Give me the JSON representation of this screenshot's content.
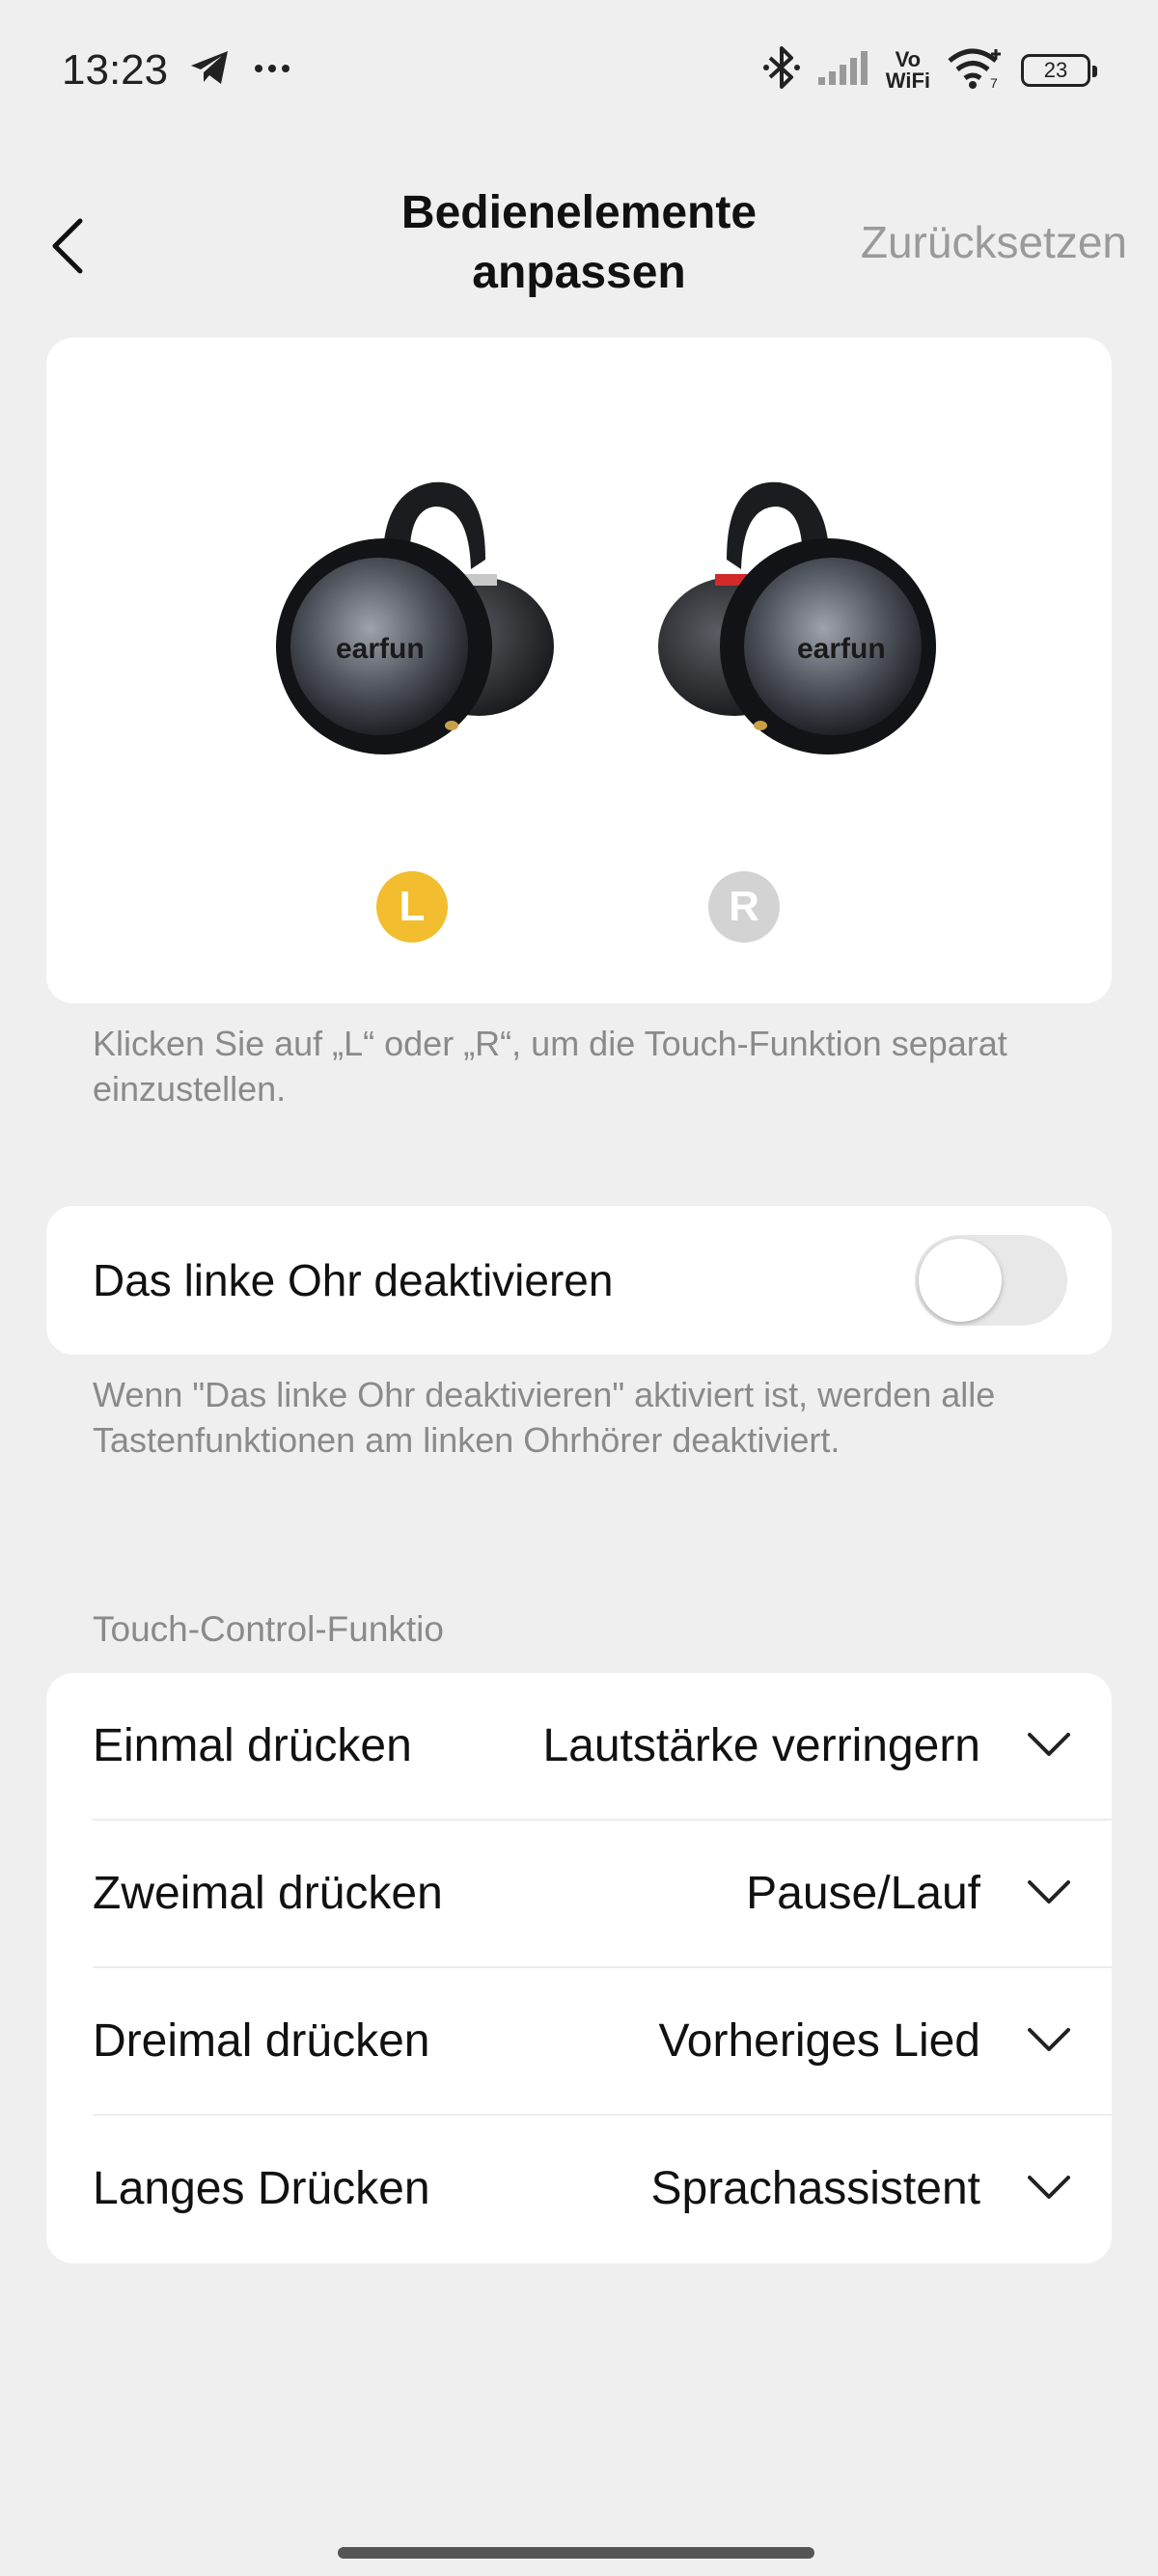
{
  "status_bar": {
    "time": "13:23",
    "left_icons": [
      "telegram-icon",
      "more-dots-icon"
    ],
    "vowifi_top": "Vo",
    "vowifi_bottom": "WiFi",
    "battery": "23"
  },
  "header": {
    "title": "Bedienelemente anpassen",
    "reset_label": "Zurücksetzen"
  },
  "earbuds": {
    "left_badge": "L",
    "right_badge": "R",
    "left_brand": "earfun",
    "right_brand": "earfun",
    "active_color": "#f2be2f",
    "inactive_color": "#d3d3d3",
    "selected": "L",
    "hint": "Klicken Sie auf „L“ oder „R“, um die Touch-Funktion separat einzustellen."
  },
  "disable_left": {
    "label": "Das linke Ohr deaktivieren",
    "enabled": false,
    "hint": "Wenn \"Das linke Ohr deaktivieren\" aktiviert ist, werden alle Tastenfunktionen am linken Ohrhörer deaktiviert."
  },
  "touch_controls": {
    "section_title": "Touch-Control-Funktio",
    "rows": [
      {
        "label": "Einmal drücken",
        "value": "Lautstärke verringern"
      },
      {
        "label": "Zweimal drücken",
        "value": "Pause/Lauf"
      },
      {
        "label": "Dreimal drücken",
        "value": "Vorheriges Lied"
      },
      {
        "label": "Langes Drücken",
        "value": "Sprachassistent"
      }
    ]
  }
}
